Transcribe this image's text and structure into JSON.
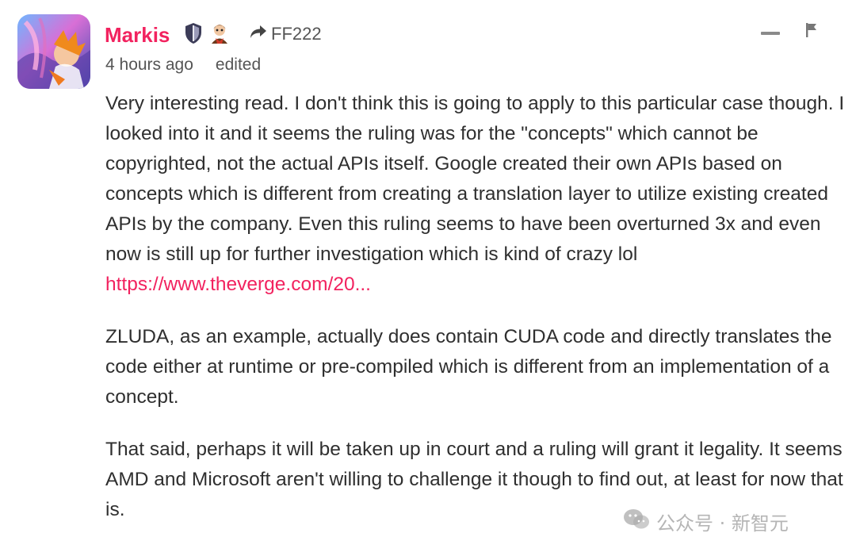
{
  "author": {
    "name": "Markis",
    "badges": [
      "shield-badge-icon",
      "character-badge-icon"
    ],
    "reply_to": "FF222"
  },
  "meta": {
    "time": "4 hours ago",
    "edited": "edited"
  },
  "body": {
    "p1_text": "Very interesting read. I don't think this is going to apply to this particular case though. I looked into it and it seems the ruling was for the \"concepts\" which cannot be copyrighted, not the actual APIs itself. Google created their own APIs based on concepts which is different from creating a translation layer to utilize existing created APIs by the company. Even this ruling seems to have been overturned 3x and even now is still up for further investigation which is kind of crazy lol",
    "p1_link": "https://www.theverge.com/20...",
    "p2": "ZLUDA, as an example, actually does contain CUDA code and directly translates the code either at runtime or pre-compiled which is different from an implementation of a concept.",
    "p3": "That said, perhaps it will be taken up in court and a ruling will grant it legality. It seems AMD and Microsoft aren't willing to challenge it though to find out, at least for now that is."
  },
  "watermark": {
    "text": "公众号 · 新智元"
  },
  "colors": {
    "accent": "#f2225f",
    "text": "#2f2f2f",
    "muted": "#555555"
  }
}
